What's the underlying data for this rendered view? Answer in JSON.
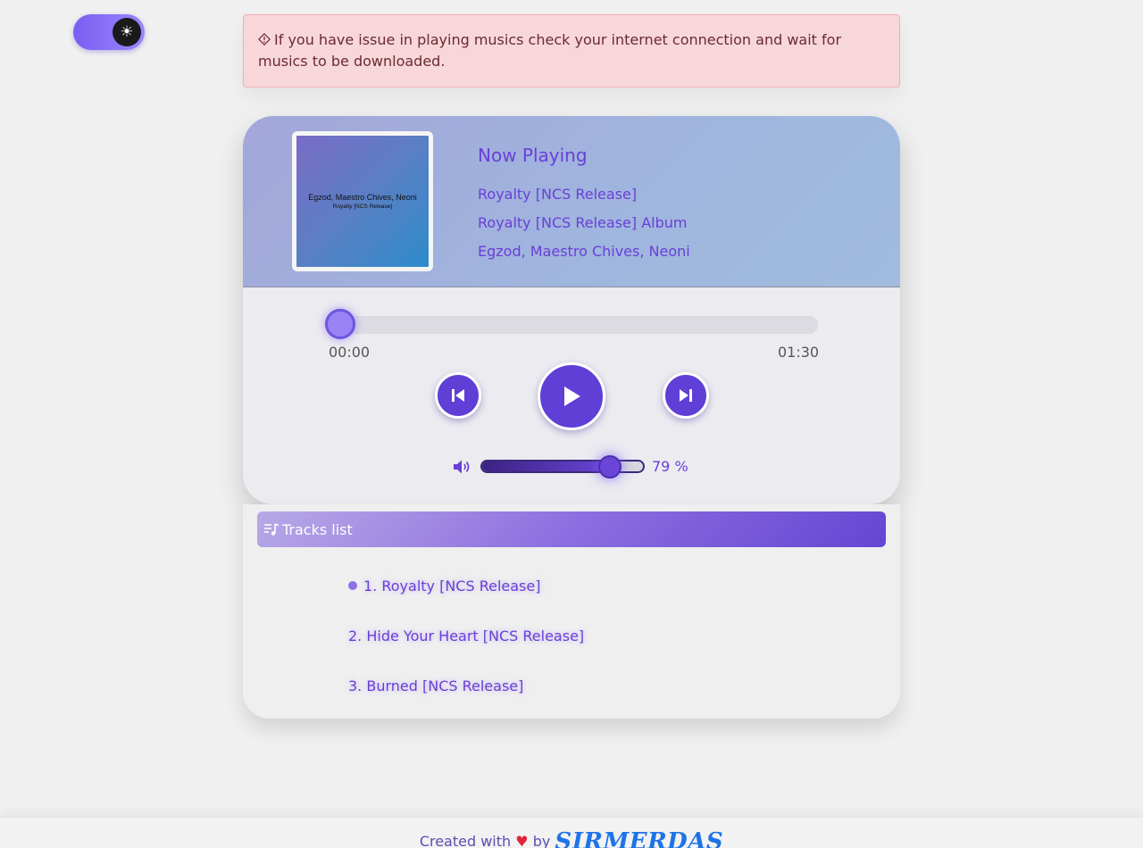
{
  "theme_toggle": {
    "icon": "sun-icon",
    "glyph": "☀"
  },
  "alert": {
    "icon": "warning-diamond-icon",
    "text": "If you have issue in playing musics check your internet connection and wait for musics to be downloaded."
  },
  "player": {
    "cover": {
      "artist": "Egzod, Maestro Chives, Neoni",
      "title": "Royalty [NCS Release]"
    },
    "now_playing_label": "Now Playing",
    "song_title": "Royalty [NCS Release]",
    "album": "Royalty [NCS Release] Album",
    "artist": "Egzod, Maestro Chives, Neoni",
    "current_time": "00:00",
    "duration": "01:30",
    "progress": 0,
    "volume": 79,
    "volume_text": "79 %",
    "controls": {
      "prev": "previous-icon",
      "play": "play-icon",
      "next": "next-icon"
    }
  },
  "tracks": {
    "header_label": "Tracks list",
    "items": [
      {
        "label": "1. Royalty [NCS Release]",
        "active": true
      },
      {
        "label": "2. Hide Your Heart [NCS Release]",
        "active": false
      },
      {
        "label": "3. Burned [NCS Release]",
        "active": false
      }
    ]
  },
  "footer": {
    "created_with": "Created with",
    "heart": "♥",
    "by": "by",
    "author": "SIRMERDAS"
  },
  "colors": {
    "accent": "#5f3fd6",
    "alert_bg": "#f8d7da",
    "author": "#1e73e8"
  }
}
